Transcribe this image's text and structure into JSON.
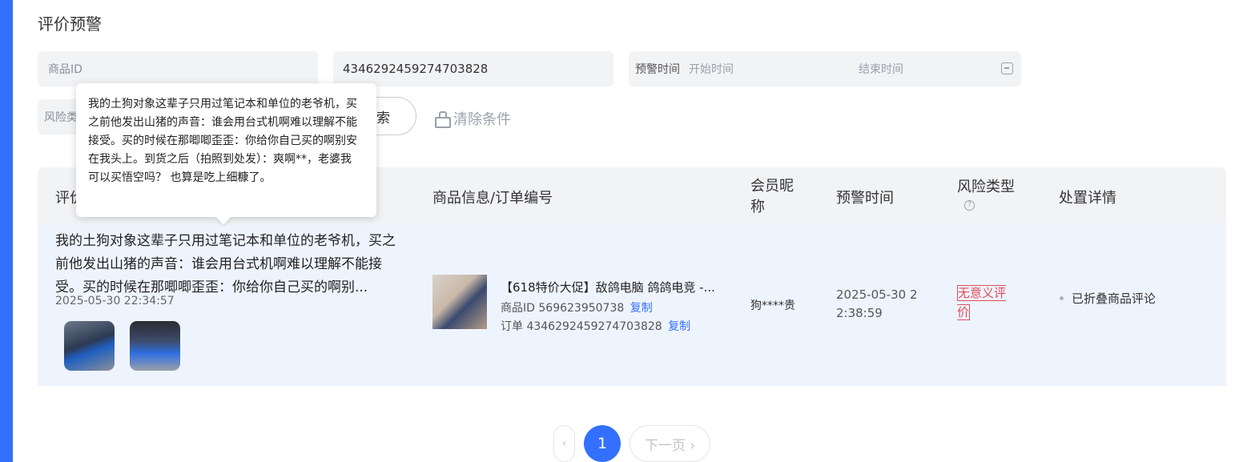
{
  "page": {
    "title": "评价预警"
  },
  "filters": {
    "product_id_label": "商品ID",
    "order_value": "4346292459274703828",
    "alert_time_label": "预警时间",
    "start_placeholder": "开始时间",
    "end_placeholder": "结束时间",
    "risk_label": "风险类",
    "search_label": "索",
    "clear_label": "清除条件"
  },
  "table": {
    "headers": {
      "review": "评价",
      "product": "商品信息/订单编号",
      "member": "会员昵称",
      "alert_time": "预警时间",
      "risk_type": "风险类型",
      "disposal": "处置详情"
    },
    "rows": [
      {
        "review_text": "我的土狗对象这辈子只用过笔记本和单位的老爷机，买之前他发出山猪的声音：谁会用台式机啊难以理解不能接受。买的时候在那唧唧歪歪：你给你自己买的啊别...",
        "review_time": "2025-05-30 22:34:57",
        "product_title": "【618特价大促】敌鸽电脑 鸽鸽电竞 -...",
        "product_id_prefix": "商品ID",
        "product_id": "569623950738",
        "copy_label": "复制",
        "order_prefix": "订单",
        "order_no": "4346292459274703828",
        "member": "狗****贵",
        "alert_time": "2025-05-30 22:38:59",
        "risk_type": "无意义评价",
        "disposal": "已折叠商品评论"
      }
    ]
  },
  "tooltip": {
    "text": "我的土狗对象这辈子只用过笔记本和单位的老爷机，买之前他发出山猪的声音：谁会用台式机啊难以理解不能接受。买的时候在那唧唧歪歪：你给你自己买的啊别安在我头上。到货之后（拍照到处发）：爽啊**，老婆我可以买悟空吗？ 也算是吃上细糠了。"
  },
  "pagination": {
    "prev": "‹",
    "current": "1",
    "next": "下一页 ›"
  },
  "colors": {
    "accent": "#3370ff",
    "risk": "#e34d59",
    "row_bg": "#eef4fd",
    "header_bg": "#f2f3f5"
  }
}
